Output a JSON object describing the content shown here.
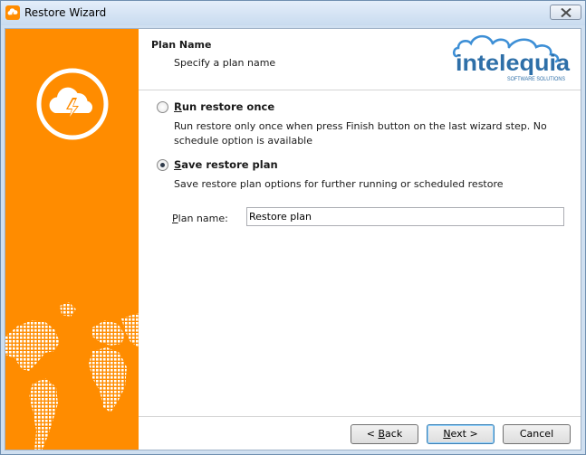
{
  "window": {
    "title": "Restore Wizard"
  },
  "header": {
    "title": "Plan Name",
    "subtitle": "Specify a plan name",
    "brand": {
      "name": "intelequia",
      "tagline": "SOFTWARE SOLUTIONS",
      "cloud_color": "#3d8fd6",
      "text_color": "#2e6fa8"
    }
  },
  "sidebar": {
    "color": "#ff8c00",
    "icon": "cloud-lightning-icon",
    "graphic": "world-map"
  },
  "options": {
    "run_once": {
      "label_accel": "R",
      "label_rest": "un restore once",
      "description": "Run restore only once when press Finish button on the last wizard step. No schedule option is available",
      "selected": false
    },
    "save_plan": {
      "label_accel": "S",
      "label_rest": "ave restore plan",
      "description": "Save restore plan options for further running or scheduled restore",
      "selected": true
    }
  },
  "plan_name": {
    "label_accel": "P",
    "label_rest": "lan name:",
    "value": "Restore plan"
  },
  "buttons": {
    "back": {
      "prefix": "< ",
      "accel": "B",
      "rest": "ack"
    },
    "next": {
      "accel": "N",
      "rest": "ext >"
    },
    "cancel": {
      "label": "Cancel"
    }
  }
}
